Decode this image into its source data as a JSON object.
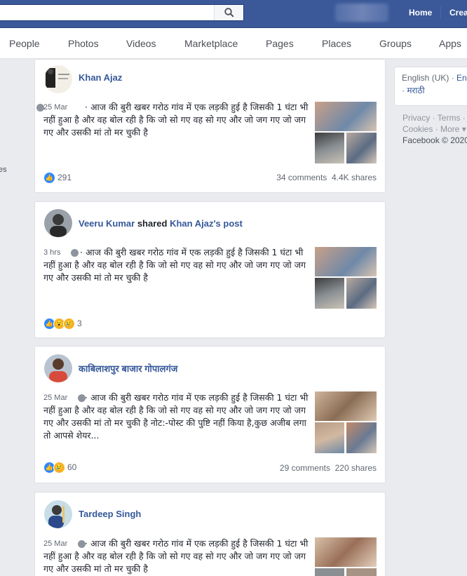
{
  "topbar": {
    "home_label": "Home",
    "create_label": "Crea"
  },
  "tabs": [
    "People",
    "Photos",
    "Videos",
    "Marketplace",
    "Pages",
    "Places",
    "Groups",
    "Apps"
  ],
  "left_cut_text": "es",
  "right_column": {
    "lang_current": "English (UK) · ",
    "lang_next": "En",
    "lang_other": "· मराठी",
    "footer_line1": "Privacy · Terms ·",
    "footer_line2": "Cookies · More ▾",
    "copyright": "Facebook © 2020"
  },
  "posts": [
    {
      "author": "Khan Ajaz",
      "time": "25 Mar",
      "text": "· आज की बुरी खबर गरोठ गांव में एक लड़की हुई है जिसकी 1 घंटा भी नहीं हुआ है और वह बोल रही है कि जो सो गए वह सो गए और जो जग गए जो जग गए और उसकी मां तो मर चुकी है",
      "reaction_count": "291",
      "comments": "34 comments",
      "shares": "4.4K shares"
    },
    {
      "author": "Veeru Kumar",
      "shared_word": "shared",
      "shared_target": "Khan Ajaz's post",
      "time": "3 hrs",
      "text": "· आज की बुरी खबर गरोठ गांव में एक लड़की हुई है जिसकी 1 घंटा भी नहीं हुआ है और वह बोल रही है कि जो सो गए वह सो गए और जो जग गए जो जग गए और उसकी मां तो मर चुकी है",
      "reaction_count": "3"
    },
    {
      "author": "काबिलाशपुर बाजार गोपालगंज",
      "time": "25 Mar",
      "text": "· आज की बुरी खबर गरोठ गांव में एक लड़की हुई है जिसकी 1 घंटा भी नहीं हुआ है और वह बोल रही है कि जो सो गए वह सो गए और जो जग गए जो जग गए और उसकी मां तो मर चुकी है नोट:-पोस्ट की पुष्टि नहीं किया है,कुछ अजीब लगा तो आपसे शेयर...",
      "reaction_count": "60",
      "comments": "29 comments",
      "shares": "220 shares"
    },
    {
      "author": "Tardeep Singh",
      "time": "25 Mar",
      "text": "· आज की बुरी खबर गरोठ गांव में एक लड़की हुई है जिसकी 1 घंटा भी नहीं हुआ है और वह बोल रही है कि जो सो गए वह सो गए और जो जग गए जो जग गए और उसकी मां तो मर चुकी है"
    }
  ]
}
